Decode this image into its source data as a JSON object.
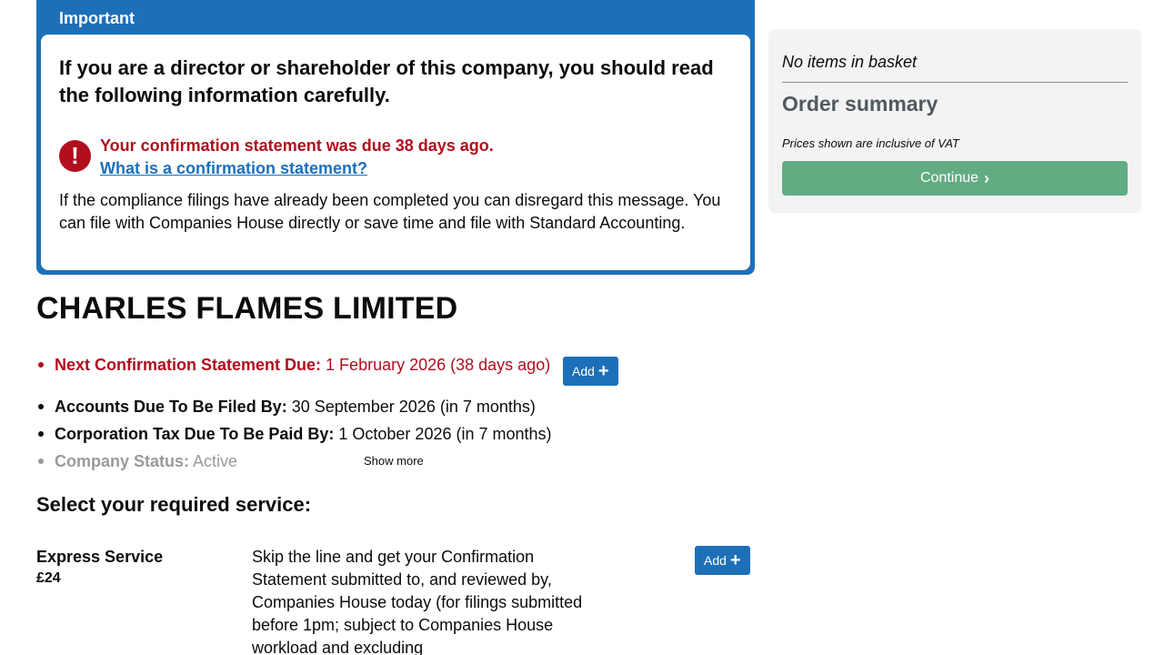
{
  "notice": {
    "header": "Important",
    "heading": "If you are a director or shareholder of this company, you should read the following information carefully.",
    "due_message": "Your confirmation statement was due 38 days ago.",
    "link_text": "What is a confirmation statement?",
    "paragraph": "If the compliance filings have already been completed you can disregard this message. You can file with Companies House directly or save time and file with Standard Accounting.",
    "icon": "!",
    "color": "#1d70b8",
    "warning_color": "#b10e1e"
  },
  "company": {
    "name": "CHARLES FLAMES LIMITED"
  },
  "details": {
    "confirmation": {
      "label": "Next Confirmation Statement Due:",
      "value": "1 February 2026 (38 days ago)",
      "add_label": "Add",
      "add_icon": "+"
    },
    "accounts": {
      "label": "Accounts Due To Be Filed By:",
      "value": "30 September 2026 (in 7 months)"
    },
    "corp_tax": {
      "label": "Corporation Tax Due To Be Paid By:",
      "value": "1 October 2026 (in 7 months)"
    },
    "status": {
      "label": "Company Status:",
      "value": "Active"
    },
    "show_more": "Show more"
  },
  "services": {
    "title": "Select your required service:",
    "items": [
      {
        "name": "Express Service",
        "price": "£24",
        "description": "Skip the line and get your Confirmation Statement submitted to, and reviewed by, Companies House today (for filings submitted before 1pm; subject to Companies House workload and excluding",
        "add_label": "Add",
        "add_icon": "+"
      }
    ]
  },
  "basket": {
    "empty_text": "No items in basket",
    "summary_title": "Order summary",
    "vat_note": "Prices shown are inclusive of VAT",
    "continue_label": "Continue",
    "continue_icon": "›",
    "continue_color": "#62ac84"
  }
}
